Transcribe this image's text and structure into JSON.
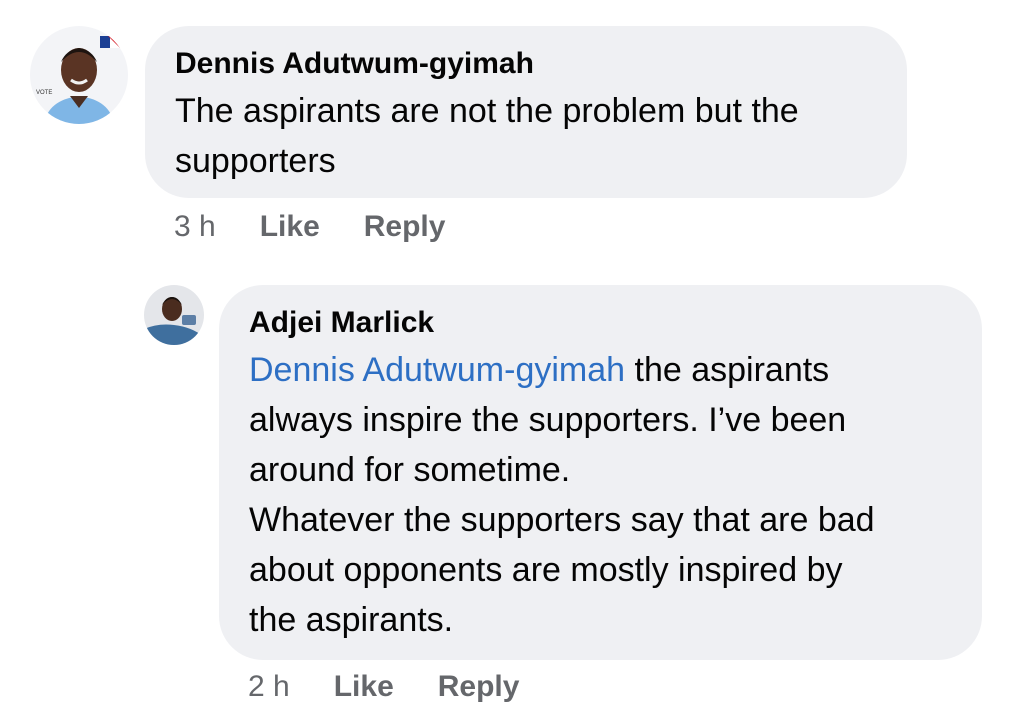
{
  "comments": [
    {
      "author": "Dennis Adutwum-gyimah",
      "avatar_icon": "profile-photo-with-vote-badge",
      "text_lines": [
        "The aspirants are not the problem but the",
        "supporters"
      ],
      "time": "3 h",
      "like_label": "Like",
      "reply_label": "Reply"
    },
    {
      "author": "Adjei Marlick",
      "avatar_icon": "profile-photo",
      "mention": "Dennis Adutwum-gyimah",
      "text_after_mention": " the aspirants",
      "text_lines": [
        "always inspire the supporters. I’ve been",
        "around for sometime.",
        "Whatever the supporters say that are bad",
        "about opponents are mostly inspired by",
        "the aspirants."
      ],
      "time": "2 h",
      "like_label": "Like",
      "reply_label": "Reply"
    }
  ],
  "colors": {
    "bubble": "#eff0f3",
    "mention": "#2d6fc4",
    "meta": "#65676b"
  }
}
